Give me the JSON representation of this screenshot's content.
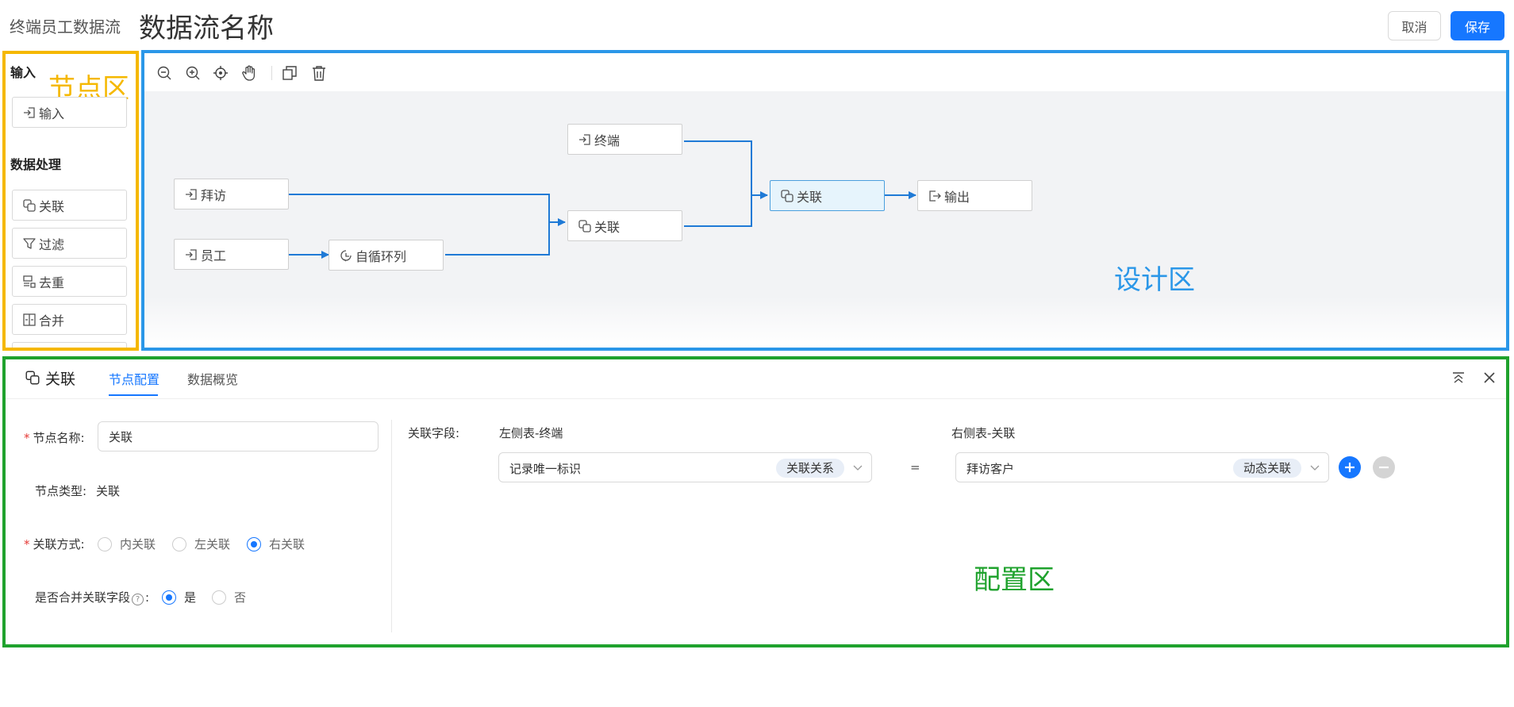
{
  "header": {
    "app_title": "终端员工数据流",
    "flow_name": "数据流名称",
    "cancel_label": "取消",
    "save_label": "保存"
  },
  "node_panel": {
    "zone_label": "节点区",
    "input_section": "输入",
    "input_items": [
      {
        "label": "输入",
        "icon": "input-icon"
      }
    ],
    "processing_section": "数据处理",
    "processing_items": [
      {
        "label": "关联",
        "icon": "join-icon"
      },
      {
        "label": "过滤",
        "icon": "filter-icon"
      },
      {
        "label": "去重",
        "icon": "dedupe-icon"
      },
      {
        "label": "合并",
        "icon": "merge-icon"
      }
    ]
  },
  "design_area": {
    "zone_label": "设计区",
    "toolbar": [
      "zoom-out-icon",
      "zoom-in-icon",
      "locate-icon",
      "pan-hand-icon",
      "copy-icon",
      "delete-icon"
    ],
    "nodes": {
      "visit": "拜访",
      "employee": "员工",
      "self_loop": "自循环列",
      "terminal": "终端",
      "join1": "关联",
      "join2": "关联",
      "output": "输出"
    },
    "selected_node": "join2"
  },
  "config": {
    "zone_label": "配置区",
    "node_title": "关联",
    "tabs": [
      "节点配置",
      "数据概览"
    ],
    "active_tab": 0,
    "node_name_label": "节点名称:",
    "node_name_value": "关联",
    "node_type_label": "节点类型:",
    "node_type_value": "关联",
    "join_mode_label": "关联方式:",
    "join_modes": [
      "内关联",
      "左关联",
      "右关联"
    ],
    "join_mode_selected": 2,
    "merge_fields_label": "是否合并关联字段",
    "merge_options": [
      "是",
      "否"
    ],
    "merge_selected": 0,
    "join_fields_label": "关联字段:",
    "left_table_label": "左侧表-终端",
    "right_table_label": "右侧表-关联",
    "left_field": "记录唯一标识",
    "left_tag": "关联关系",
    "equals": "=",
    "right_field": "拜访客户",
    "right_tag": "动态关联"
  },
  "colors": {
    "primary": "#1677ff",
    "edge": "#1f7ad6",
    "node_zone": "#f5b800",
    "design_zone": "#2b97e8",
    "config_zone": "#1fa22d"
  }
}
